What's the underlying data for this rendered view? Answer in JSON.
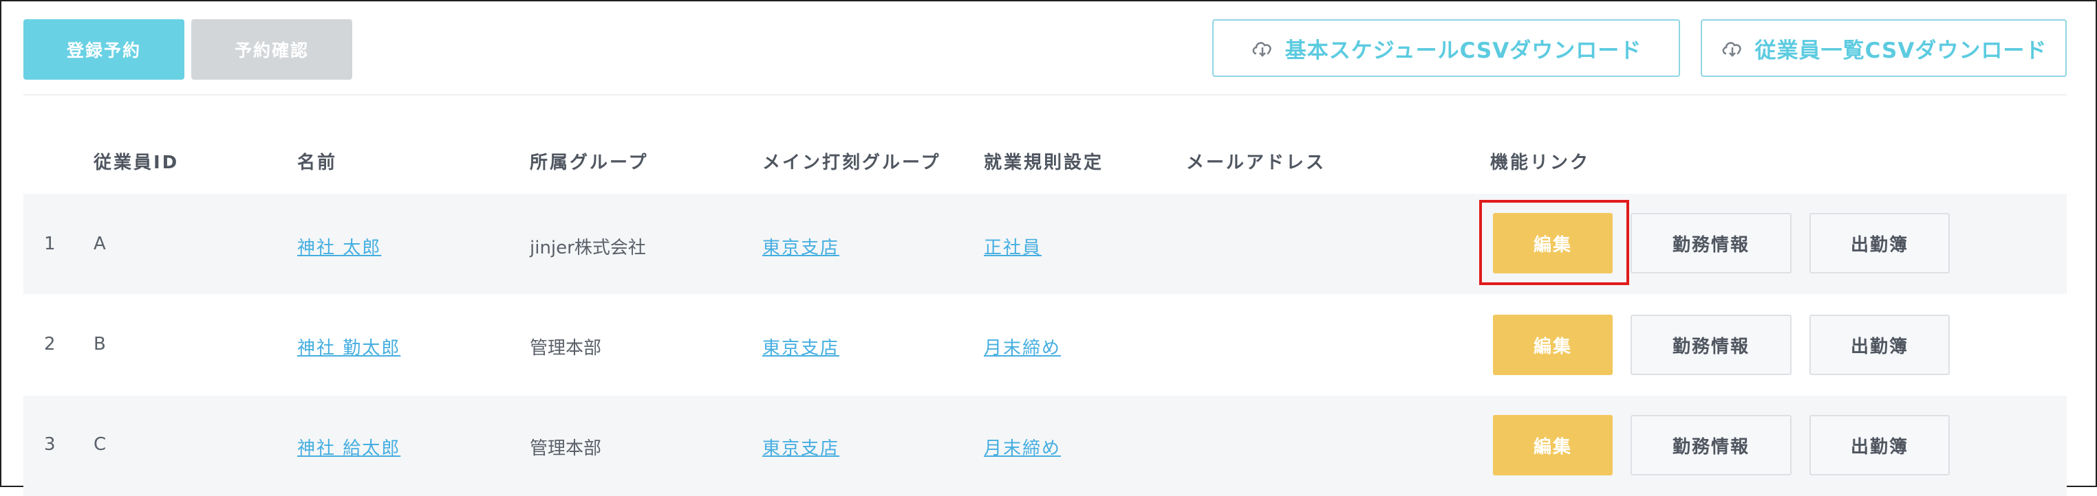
{
  "toolbar": {
    "register_label": "登録予約",
    "confirm_label": "予約確認",
    "csv_schedule_label": "基本スケジュールCSVダウンロード",
    "csv_employees_label": "従業員一覧CSVダウンロード"
  },
  "table": {
    "headers": {
      "employee_id": "従業員ID",
      "name": "名前",
      "group": "所属グループ",
      "main_group": "メイン打刻グループ",
      "rule": "就業規則設定",
      "email": "メールアドレス",
      "links": "機能リンク"
    },
    "rows": [
      {
        "num": "1",
        "id": "A",
        "name": "神社 太郎",
        "group": "jinjer株式会社",
        "main_group": "東京支店",
        "rule": "正社員",
        "email": ""
      },
      {
        "num": "2",
        "id": "B",
        "name": "神社 勤太郎",
        "group": "管理本部",
        "main_group": "東京支店",
        "rule": "月末締め",
        "email": ""
      },
      {
        "num": "3",
        "id": "C",
        "name": "神社 給太郎",
        "group": "管理本部",
        "main_group": "東京支店",
        "rule": "月末締め",
        "email": ""
      }
    ],
    "actions": {
      "edit": "編集",
      "work_info": "勤務情報",
      "attendance_book": "出勤簿"
    }
  },
  "colors": {
    "primary": "#69d1e4",
    "disabled": "#d3d6d9",
    "edit": "#f2c85e",
    "link": "#45aee0",
    "highlight": "#e01b1b"
  },
  "icons": {
    "csv": "cloud-download-icon"
  }
}
